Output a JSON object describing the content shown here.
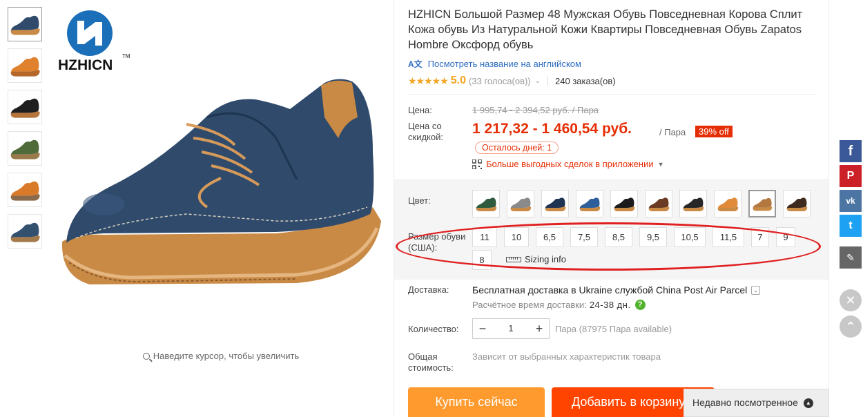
{
  "gallery": {
    "thumbnails": [
      {
        "name": "navy suede shoe",
        "color": "#2f4a6b",
        "sole": "#c98a46"
      },
      {
        "name": "orange suede shoe",
        "color": "#e0822d",
        "sole": "#b5682a"
      },
      {
        "name": "black suede shoe",
        "color": "#1e1e1e",
        "sole": "#b5743a"
      },
      {
        "name": "green shoe on person",
        "color": "#4f6b3a",
        "sole": "#9a7a4a"
      },
      {
        "name": "orange shoes on person",
        "color": "#d9792a",
        "sole": "#8a6a4a"
      },
      {
        "name": "navy shoes on person",
        "color": "#34506f",
        "sole": "#a57a4a"
      }
    ],
    "brand_logo": "HZHICN",
    "brand_tm": "TM",
    "zoom_hint": "Наведите курсор, чтобы увеличить"
  },
  "product": {
    "title": "HZHICN Большой Размер 48 Мужская Обувь Повседневная Корова Сплит Кожа обувь Из Натуральной Кожи Квартиры Повседневная Обувь Zapatos Hombre Оксфорд обувь",
    "translate_link": "Посмотреть название на английском",
    "rating": "5.0",
    "votes": "(33 голоса(ов))",
    "orders": "240 заказа(ов)"
  },
  "price": {
    "label": "Цена:",
    "old": "1 995,74 - 2 394,52 руб. / Пара",
    "discount_label": "Цена со скидкой:",
    "new": "1 217,32 - 1 460,54 руб.",
    "per_unit": "/ Пара",
    "discount": "39% off",
    "days_left": "Осталось дней: 1",
    "app_deals": "Больше выгодных сделок в приложении"
  },
  "sku": {
    "color_label": "Цвет:",
    "colors": [
      {
        "name": "green",
        "hex": "#2e5a3e"
      },
      {
        "name": "gray",
        "hex": "#8a8a8a"
      },
      {
        "name": "dark blue",
        "hex": "#1f3352"
      },
      {
        "name": "blue",
        "hex": "#2e5f9a"
      },
      {
        "name": "black",
        "hex": "#1b1b1b"
      },
      {
        "name": "brown",
        "hex": "#6b3a22"
      },
      {
        "name": "black lace",
        "hex": "#262626"
      },
      {
        "name": "orange",
        "hex": "#e08a3a"
      },
      {
        "name": "khaki",
        "hex": "#b3783f"
      },
      {
        "name": "dark brown",
        "hex": "#3e2a1e"
      }
    ],
    "selected_color": 8,
    "size_label": "Размер обуви (США):",
    "sizes": [
      "11",
      "10",
      "6,5",
      "7,5",
      "8,5",
      "9,5",
      "10,5",
      "11,5",
      "7",
      "9",
      "8"
    ],
    "sizing_info": "Sizing info"
  },
  "shipping": {
    "label": "Доставка:",
    "text": "Бесплатная доставка в Ukraine службой China Post Air Parcel",
    "estimate_label": "Расчётное время доставки:",
    "estimate_days": "24-38 дн."
  },
  "quantity": {
    "label": "Количество:",
    "value": "1",
    "minus": "−",
    "plus": "+",
    "available": "Пара (87975 Пара available)"
  },
  "total": {
    "label": "Общая стоимость:",
    "text": "Зависит от выбранных характеристик товара"
  },
  "actions": {
    "buy_now": "Купить сейчас",
    "add_to_cart": "Добавить в корзину"
  },
  "recently_viewed": "Недавно посмотренное",
  "social": {
    "facebook": "f",
    "pinterest": "P",
    "vk": "vk",
    "twitter": "t",
    "edit": "✎",
    "close": "✕",
    "top": "⌃"
  },
  "colors": {
    "accent_red": "#e62e04",
    "buy_orange": "#ff9a2e",
    "cart_orange": "#ff4400",
    "link_blue": "#2f6ec1",
    "star": "#f5a623"
  }
}
